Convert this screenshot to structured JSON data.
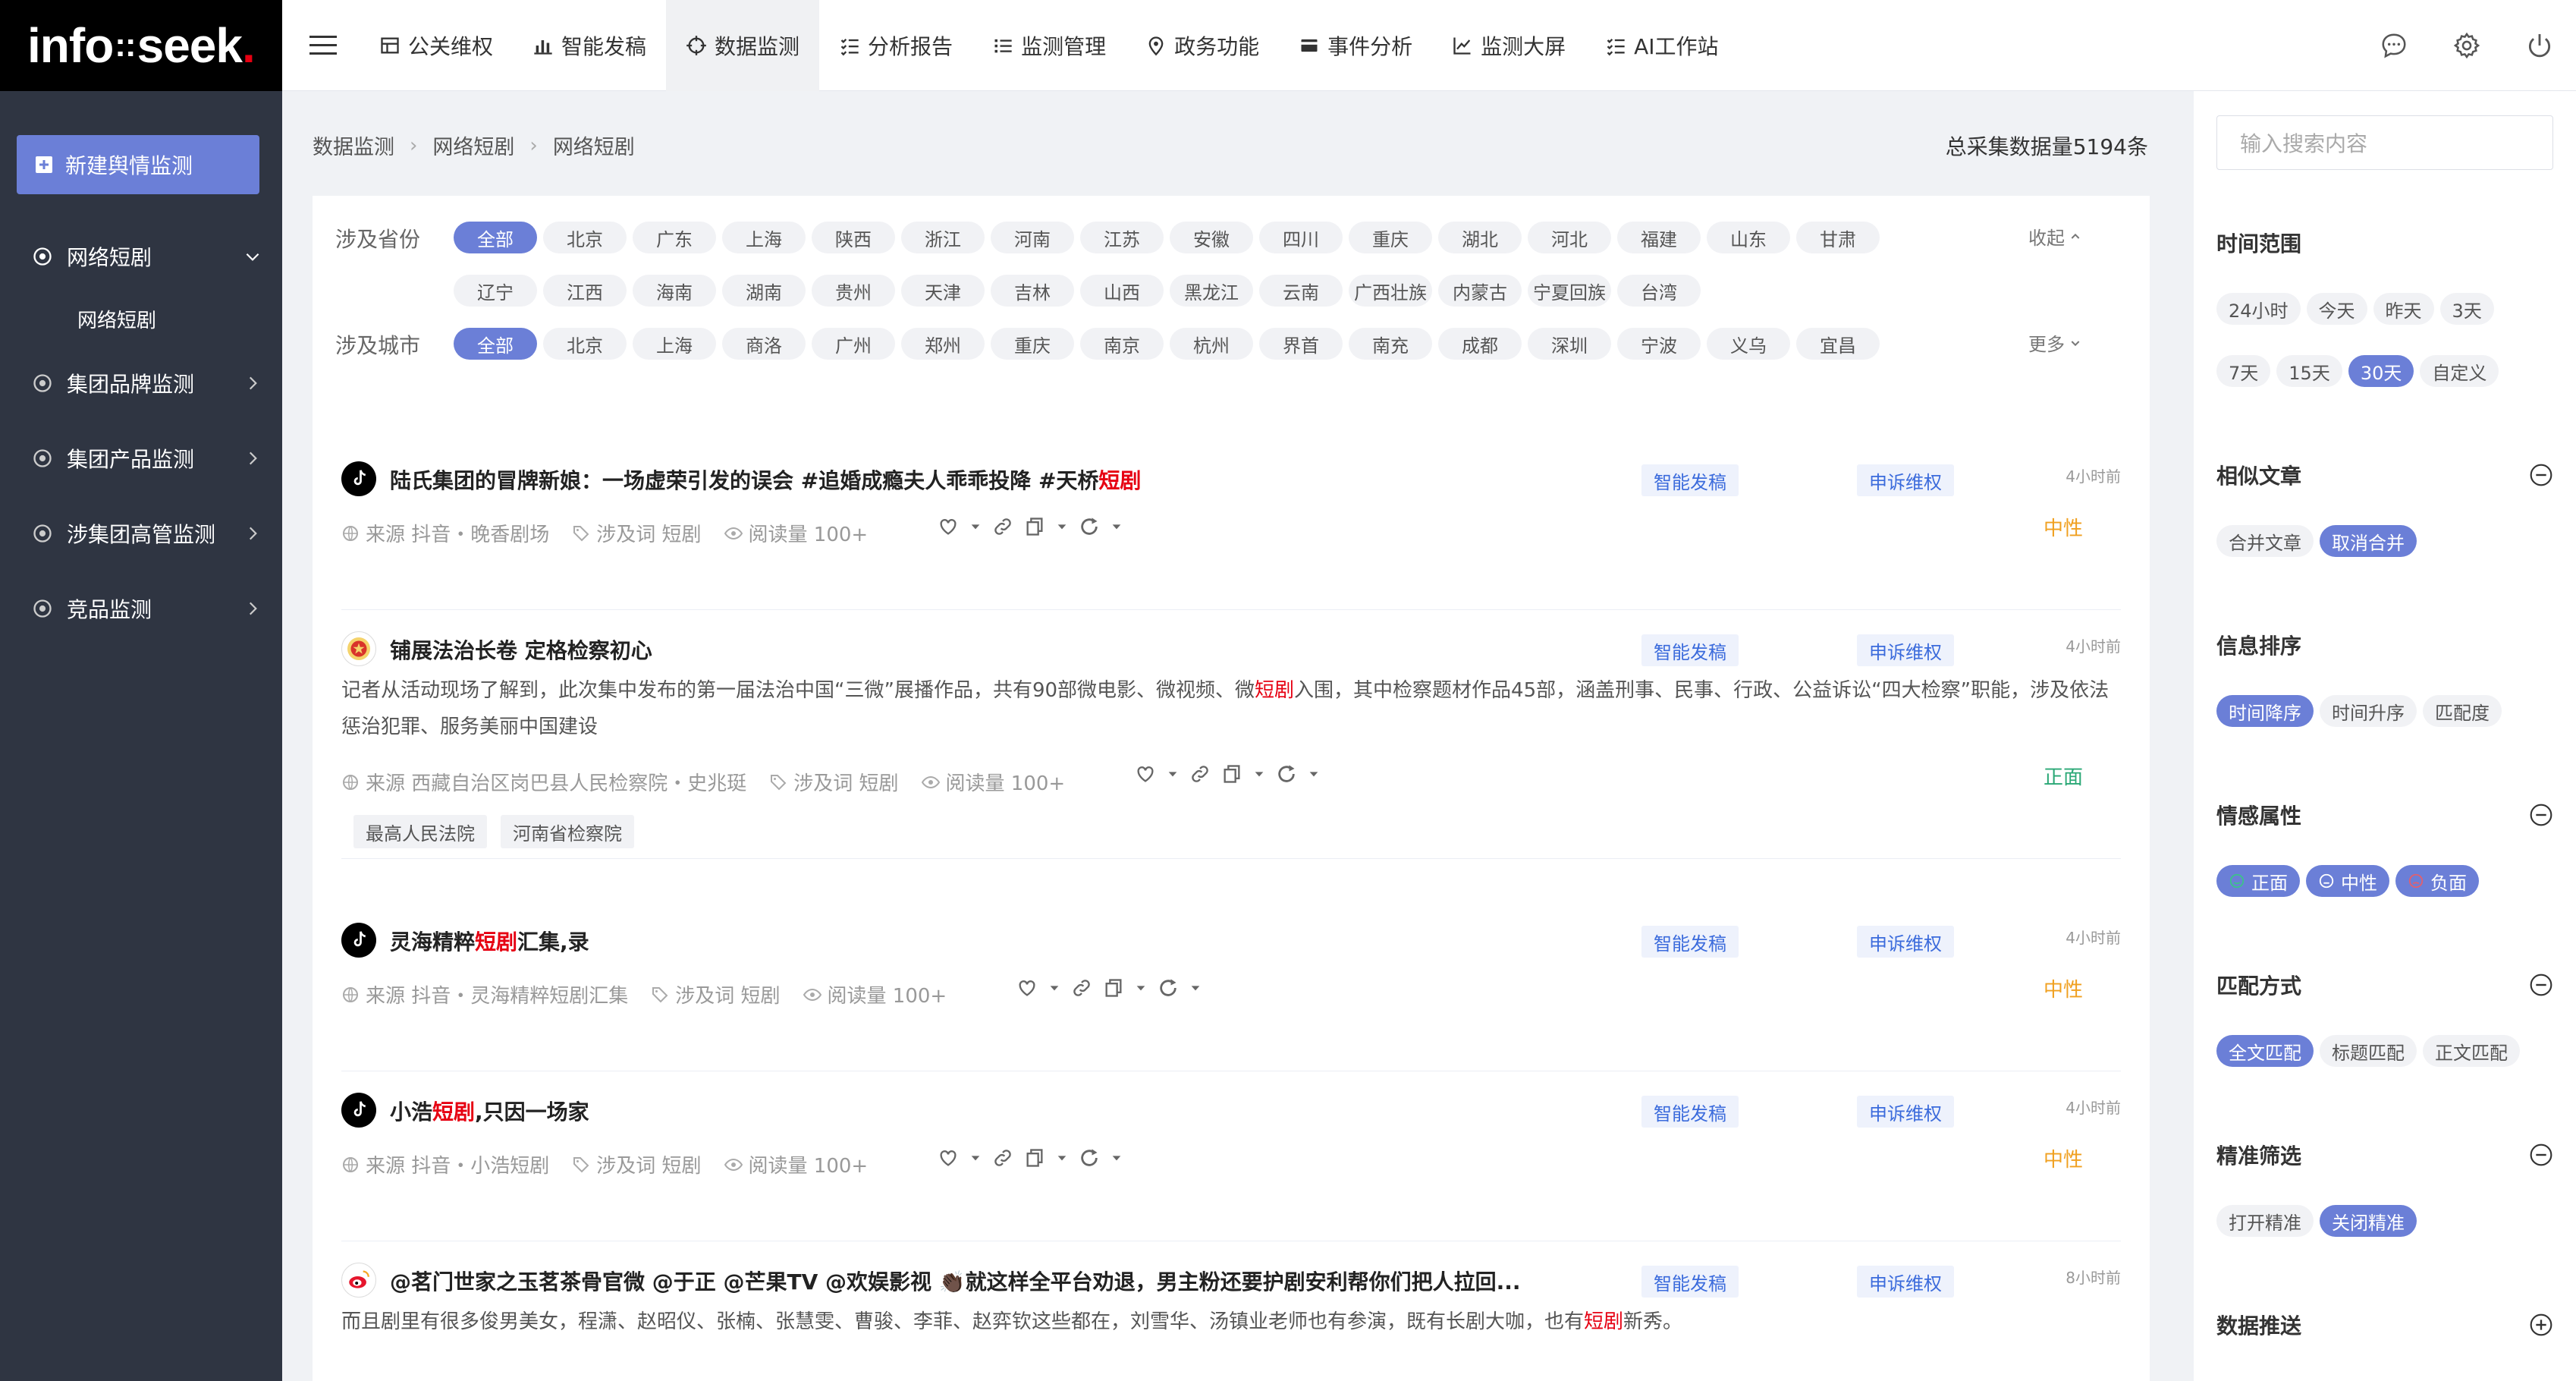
{
  "app": {
    "logo_main": "info",
    "logo_dots": "::",
    "logo_end": "seek",
    "logo_dot": "."
  },
  "nav": {
    "items": [
      {
        "label": "公关维权",
        "icon": "table-icon"
      },
      {
        "label": "智能发稿",
        "icon": "bar-chart-icon"
      },
      {
        "label": "数据监测",
        "icon": "crosshair-icon"
      },
      {
        "label": "分析报告",
        "icon": "checklist-icon"
      },
      {
        "label": "监测管理",
        "icon": "list-icon"
      },
      {
        "label": "政务功能",
        "icon": "location-pin-icon"
      },
      {
        "label": "事件分析",
        "icon": "card-icon"
      },
      {
        "label": "监测大屏",
        "icon": "line-chart-icon"
      },
      {
        "label": "AI工作站",
        "icon": "checklist-icon"
      }
    ],
    "active": "数据监测"
  },
  "sidebar": {
    "new_button": "新建舆情监测",
    "items": [
      {
        "label": "网络短剧"
      },
      {
        "label": "集团品牌监测"
      },
      {
        "label": "集团产品监测"
      },
      {
        "label": "涉集团高管监测"
      },
      {
        "label": "竞品监测"
      }
    ],
    "sub_item": "网络短剧"
  },
  "breadcrumb": [
    "数据监测",
    "网络短剧",
    "网络短剧"
  ],
  "total_label": "总采集数据量5194条",
  "filters": {
    "province_label": "涉及省份",
    "provinces_row1": [
      "全部",
      "北京",
      "广东",
      "上海",
      "陕西",
      "浙江",
      "河南",
      "江苏",
      "安徽",
      "四川",
      "重庆",
      "湖北",
      "河北",
      "福建",
      "山东",
      "甘肃"
    ],
    "provinces_row2": [
      "辽宁",
      "江西",
      "海南",
      "湖南",
      "贵州",
      "天津",
      "吉林",
      "山西",
      "黑龙江",
      "云南",
      "广西壮族",
      "内蒙古",
      "宁夏回族",
      "台湾"
    ],
    "collapse_label": "收起",
    "city_label": "涉及城市",
    "cities": [
      "全部",
      "北京",
      "上海",
      "商洛",
      "广州",
      "郑州",
      "重庆",
      "南京",
      "杭州",
      "界首",
      "南充",
      "成都",
      "深圳",
      "宁波",
      "义乌",
      "宜昌"
    ],
    "more_label": "更多"
  },
  "article_common": {
    "btn_publish": "智能发稿",
    "btn_appeal": "申诉维权"
  },
  "articles": [
    {
      "title_pre": "陆氏集团的冒牌新娘：一场虚荣引发的误会 #追婚成瘾夫人乖乖投降 #天桥",
      "title_hl": "短剧",
      "title_post": "",
      "time": "4小时前",
      "sentiment": "中性",
      "source": "来源 抖音・晚香剧场",
      "keyword": "涉及词 短剧",
      "reads": "阅读量 100+"
    },
    {
      "title_pre": "铺展法治长卷 定格检察初心",
      "title_hl": "",
      "title_post": "",
      "time": "4小时前",
      "sentiment": "正面",
      "summary_pre": "记者从活动现场了解到，此次集中发布的第一届法治中国“三微”展播作品，共有90部微电影、微视频、微",
      "summary_hl": "短剧",
      "summary_post": "入围，其中检察题材作品45部，涵盖刑事、民事、行政、公益诉讼“四大检察”职能，涉及依法惩治犯罪、服务美丽中国建设",
      "source": "来源 西藏自治区岗巴县人民检察院・史兆珽",
      "keyword": "涉及词 短剧",
      "reads": "阅读量 100+",
      "tags": [
        "最高人民法院",
        "河南省检察院"
      ]
    },
    {
      "title_pre": "灵海精粹",
      "title_hl": "短剧",
      "title_post": "汇集,录",
      "time": "4小时前",
      "sentiment": "中性",
      "source": "来源 抖音・灵海精粹短剧汇集",
      "keyword": "涉及词 短剧",
      "reads": "阅读量 100+"
    },
    {
      "title_pre": "小浩",
      "title_hl": "短剧",
      "title_post": ",只因一场家",
      "time": "4小时前",
      "sentiment": "中性",
      "source": "来源 抖音・小浩短剧",
      "keyword": "涉及词 短剧",
      "reads": "阅读量 100+"
    },
    {
      "title_pre": "@茗门世家之玉茗茶骨官微 @于正 @芒果TV @欢娱影视 👏🏿就这样全平台劝退，男主粉还要护剧安利帮你们把人拉回...",
      "title_hl": "",
      "title_post": "",
      "time": "8小时前",
      "summary_pre": "而且剧里有很多俊男美女，程潇、赵昭仪、张楠、张慧雯、曹骏、李菲、赵弈钦这些都在，刘雪华、汤镇业老师也有参演，既有长剧大咖，也有",
      "summary_hl": "短剧",
      "summary_post": "新秀。"
    }
  ],
  "right_panel": {
    "search_placeholder": "输入搜索内容",
    "time_range": {
      "title": "时间范围",
      "options": [
        "24小时",
        "今天",
        "昨天",
        "3天",
        "7天",
        "15天",
        "30天",
        "自定义"
      ],
      "active": "30天"
    },
    "similar": {
      "title": "相似文章",
      "options": [
        "合并文章",
        "取消合并"
      ],
      "active": "取消合并"
    },
    "sort": {
      "title": "信息排序",
      "options": [
        "时间降序",
        "时间升序",
        "匹配度"
      ],
      "active": "时间降序"
    },
    "sentiment": {
      "title": "情感属性",
      "options": [
        "正面",
        "中性",
        "负面"
      ]
    },
    "match": {
      "title": "匹配方式",
      "options": [
        "全文匹配",
        "标题匹配",
        "正文匹配"
      ],
      "active": "全文匹配"
    },
    "precise": {
      "title": "精准筛选",
      "options": [
        "打开精准",
        "关闭精准"
      ],
      "active": "关闭精准"
    },
    "push": {
      "title": "数据推送"
    }
  },
  "colors": {
    "accent": "#6b7fd7",
    "highlight": "#e60012",
    "neutral": "#f0a020",
    "positive": "#2aa876",
    "sidebar_bg": "#2f3542"
  }
}
